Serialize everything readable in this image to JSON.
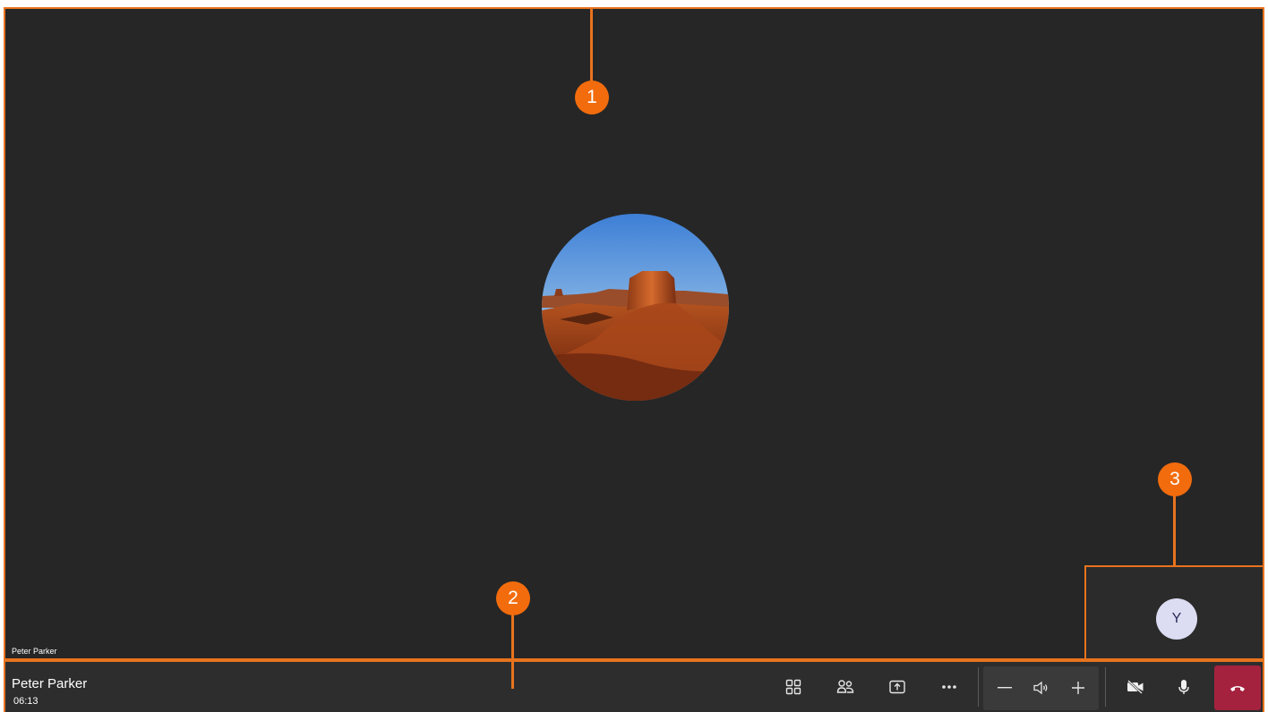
{
  "stage": {
    "participant_label": "Peter Parker"
  },
  "self_view": {
    "initial": "Y"
  },
  "call_bar": {
    "caller_name": "Peter Parker",
    "duration": "06:13",
    "buttons": [
      {
        "name": "gallery-view-button",
        "icon": "grid-icon"
      },
      {
        "name": "participants-button",
        "icon": "people-icon"
      },
      {
        "name": "share-screen-button",
        "icon": "share-icon"
      },
      {
        "name": "more-options-button",
        "icon": "more-icon"
      }
    ],
    "volume": {
      "decrease_icon": "minus-icon",
      "speaker_icon": "speaker-icon",
      "increase_icon": "plus-icon"
    },
    "camera_icon": "camera-off-icon",
    "mic_icon": "microphone-icon",
    "end_call_icon": "hang-up-icon",
    "end_call_color": "#a4223e"
  },
  "annotations": {
    "callout_1": "1",
    "callout_2": "2",
    "callout_3": "3",
    "accent_color": "#e8731e"
  }
}
